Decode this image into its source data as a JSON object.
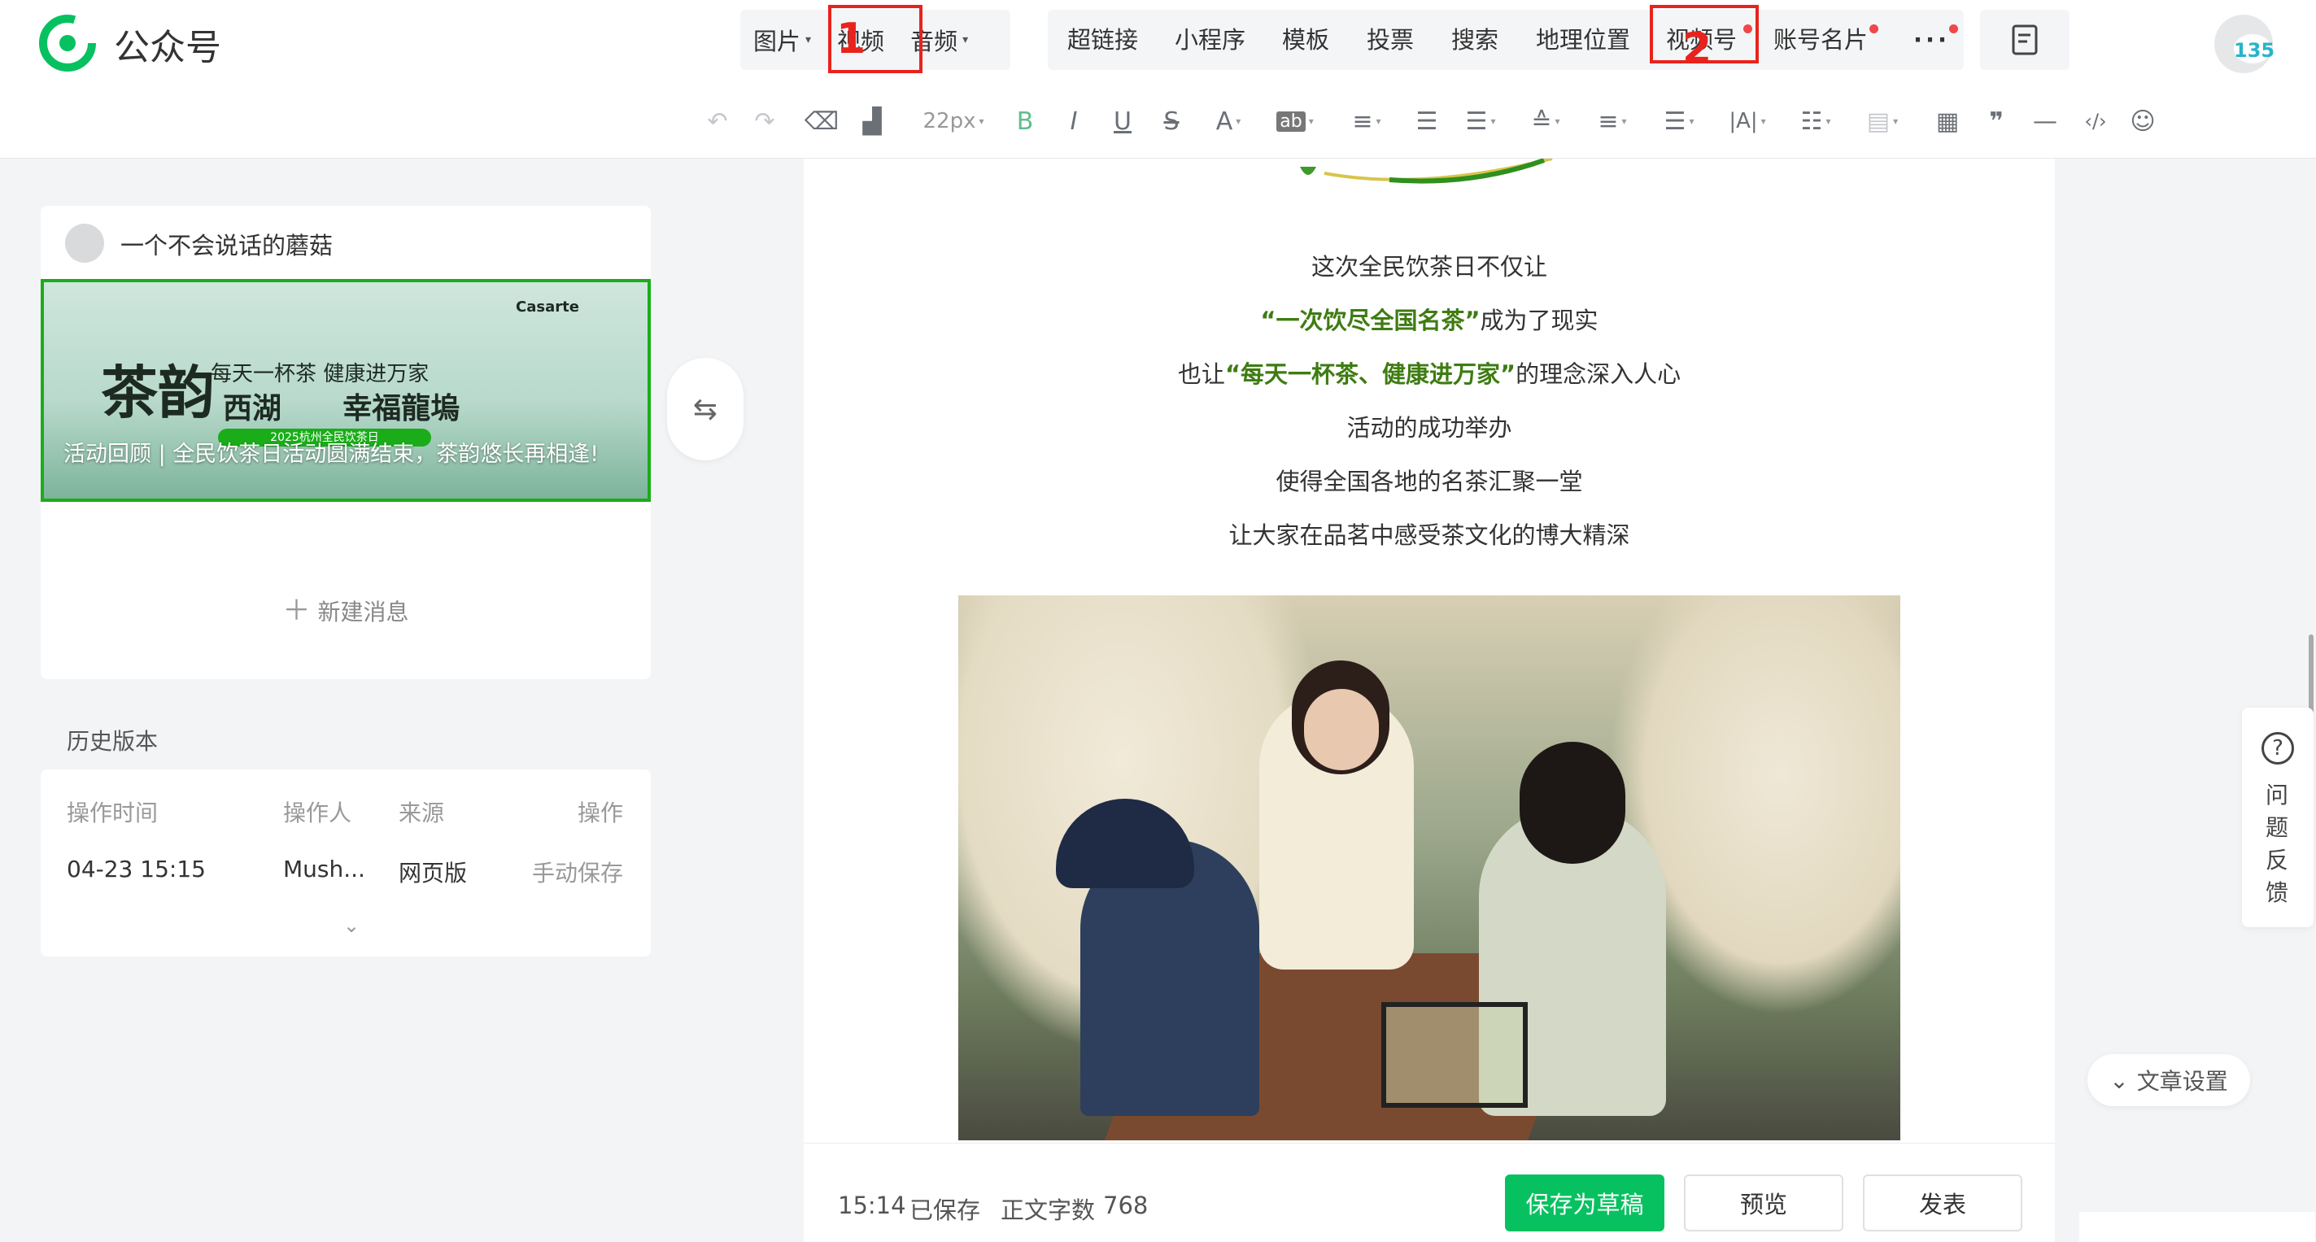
{
  "topbar": {
    "brand": "公众号",
    "media": [
      "图片",
      "视频",
      "音频"
    ],
    "insert": [
      {
        "label": "超链接"
      },
      {
        "label": "小程序"
      },
      {
        "label": "模板"
      },
      {
        "label": "投票"
      },
      {
        "label": "搜索"
      },
      {
        "label": "地理位置"
      },
      {
        "label": "视频号"
      },
      {
        "label": "账号名片"
      }
    ],
    "more": "···",
    "avatar_badge": "135"
  },
  "annotations": [
    "1",
    "2"
  ],
  "toolbar": {
    "font_size": "22px",
    "bold": "B",
    "italic": "I",
    "underline": "U",
    "strike": "S",
    "font_color": "A",
    "bg_color": "ab",
    "letter_spacing": "|A|"
  },
  "left": {
    "account_name": "一个不会说话的蘑菇",
    "cover": {
      "title": "活动回顾 | 全民饮茶日活动圆满结束，茶韵悠长再相逢!",
      "slogan": "每天一杯茶  健康进万家",
      "calligraphy": "茶韵",
      "brand": "Casarte",
      "line2": "西湖      幸福龍塢",
      "banner": "2025杭州全民饮茶日"
    },
    "new_message": "新建消息",
    "history_title": "历史版本",
    "history": {
      "headers": [
        "操作时间",
        "操作人",
        "来源",
        "操作"
      ],
      "rows": [
        [
          "04-23 15:15",
          "Mush...",
          "网页版",
          "手动保存"
        ]
      ]
    }
  },
  "article": {
    "line1": "这次全民饮茶日不仅让",
    "line2_bold": "“一次饮尽全国名茶”",
    "line2_rest": "成为了现实",
    "line3_pre": "也让",
    "line3_bold": "“每天一杯茶、健康进万家”",
    "line3_rest": "的理念深入人心",
    "line4": "活动的成功举办",
    "line5": "使得全国各地的名茶汇聚一堂",
    "line6": "让大家在品茗中感受茶文化的博大精深"
  },
  "footer": {
    "saved_time": "15:14",
    "saved_label": "已保存",
    "word_label": "正文字数",
    "word_count": "768",
    "save_draft": "保存为草稿",
    "preview": "预览",
    "publish": "发表"
  },
  "side": {
    "feedback_icon": "?",
    "feedback": "问题反馈",
    "article_settings": "文章设置"
  },
  "colors": {
    "accent": "#07c160",
    "bold_text": "#3e7c12",
    "annotation": "#e8231d"
  }
}
